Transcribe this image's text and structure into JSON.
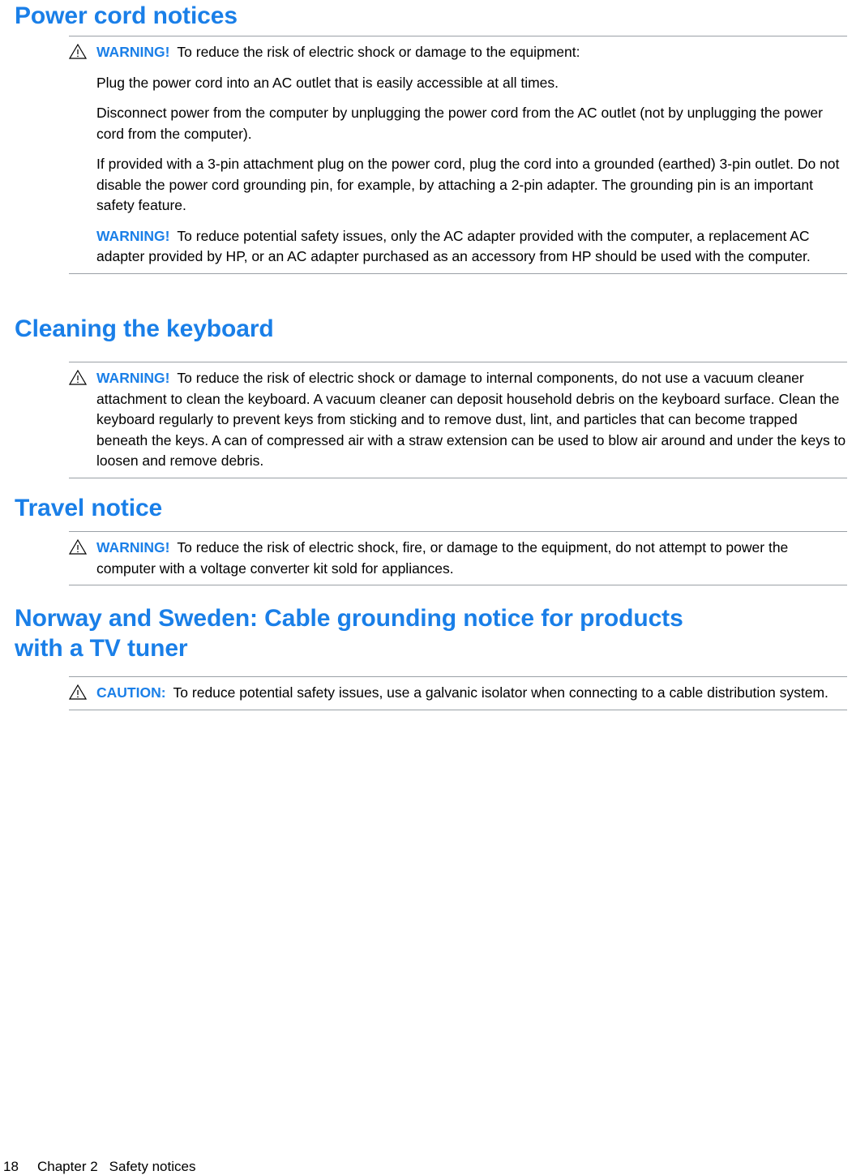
{
  "document": {
    "sections": [
      {
        "id": "power-cord-notices",
        "heading": "Power cord notices",
        "notes": [
          {
            "icon": "warning-triangle-icon",
            "paragraphs": [
              {
                "label": "WARNING!",
                "label_type": "warning",
                "text": "To reduce the risk of electric shock or damage to the equipment:"
              },
              {
                "label": "",
                "label_type": "none",
                "text": "Plug the power cord into an AC outlet that is easily accessible at all times."
              },
              {
                "label": "",
                "label_type": "none",
                "text": "Disconnect power from the computer by unplugging the power cord from the AC outlet (not by unplugging the power cord from the computer)."
              },
              {
                "label": "",
                "label_type": "none",
                "text": "If provided with a 3-pin attachment plug on the power cord, plug the cord into a grounded (earthed) 3-pin outlet. Do not disable the power cord grounding pin, for example, by attaching a 2-pin adapter. The grounding pin is an important safety feature."
              },
              {
                "label": "WARNING!",
                "label_type": "warning",
                "text": "To reduce potential safety issues, only the AC adapter provided with the computer, a replacement AC adapter provided by HP, or an AC adapter purchased as an accessory from HP should be used with the computer."
              }
            ]
          }
        ]
      },
      {
        "id": "cleaning-the-keyboard",
        "heading": "Cleaning the keyboard",
        "notes": [
          {
            "icon": "warning-triangle-icon",
            "paragraphs": [
              {
                "label": "WARNING!",
                "label_type": "warning",
                "text": "To reduce the risk of electric shock or damage to internal components, do not use a vacuum cleaner attachment to clean the keyboard. A vacuum cleaner can deposit household debris on the keyboard surface. Clean the keyboard regularly to prevent keys from sticking and to remove dust, lint, and particles that can become trapped beneath the keys. A can of compressed air with a straw extension can be used to blow air around and under the keys to loosen and remove debris."
              }
            ]
          }
        ]
      },
      {
        "id": "travel-notice",
        "heading": "Travel notice",
        "notes": [
          {
            "icon": "warning-triangle-icon",
            "paragraphs": [
              {
                "label": "WARNING!",
                "label_type": "warning",
                "text": "To reduce the risk of electric shock, fire, or damage to the equipment, do not attempt to power the computer with a voltage converter kit sold for appliances."
              }
            ]
          }
        ]
      },
      {
        "id": "norway-sweden-cable-grounding",
        "heading": "Norway and Sweden: Cable grounding notice for products with a TV tuner",
        "notes": [
          {
            "icon": "warning-triangle-icon",
            "paragraphs": [
              {
                "label": "CAUTION:",
                "label_type": "caution",
                "text": "To reduce potential safety issues, use a galvanic isolator when connecting to a cable distribution system."
              }
            ]
          }
        ]
      }
    ]
  },
  "footer": {
    "page_number": "18",
    "chapter": "Chapter 2",
    "chapter_title": "Safety notices"
  },
  "colors": {
    "heading_blue": "#1a7fe8",
    "label_blue": "#1a7fe8",
    "rule_gray": "#9aa0a6",
    "text_black": "#000000"
  }
}
